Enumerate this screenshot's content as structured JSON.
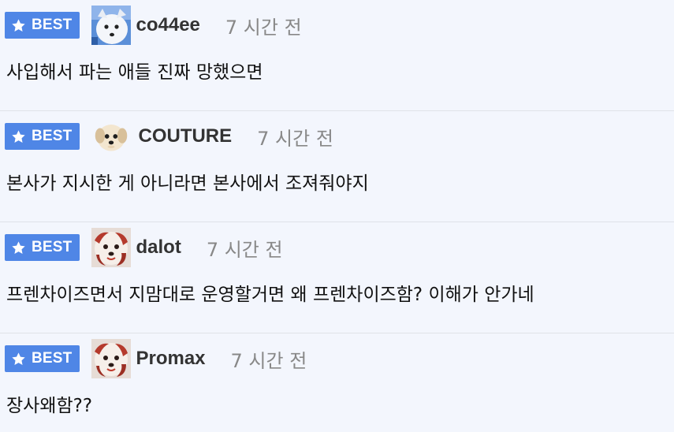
{
  "badge_label": "BEST",
  "colors": {
    "badge_bg": "#4f86e6",
    "page_bg": "#f3f6fd",
    "divider": "#dfe2e8",
    "username": "#333333",
    "time": "#888888"
  },
  "comments": [
    {
      "username": "co44ee",
      "time": "7 시간 전",
      "text": "사입해서 파는 애들 진짜 망했으면",
      "avatar_icon": "white-dog-avatar-icon"
    },
    {
      "username": "COUTURE",
      "time": "7 시간 전",
      "text": "본사가 지시한 게 아니라면 본사에서 조져줘야지",
      "avatar_icon": "puppy-face-avatar-icon"
    },
    {
      "username": "dalot",
      "time": "7 시간 전",
      "text": "프렌차이즈면서 지맘대로 운영할거면 왜 프렌차이즈함? 이해가 안가네",
      "avatar_icon": "bloody-doll-avatar-icon"
    },
    {
      "username": "Promax",
      "time": "7 시간 전",
      "text": "장사왜함??",
      "avatar_icon": "bloody-doll-avatar-icon"
    }
  ]
}
